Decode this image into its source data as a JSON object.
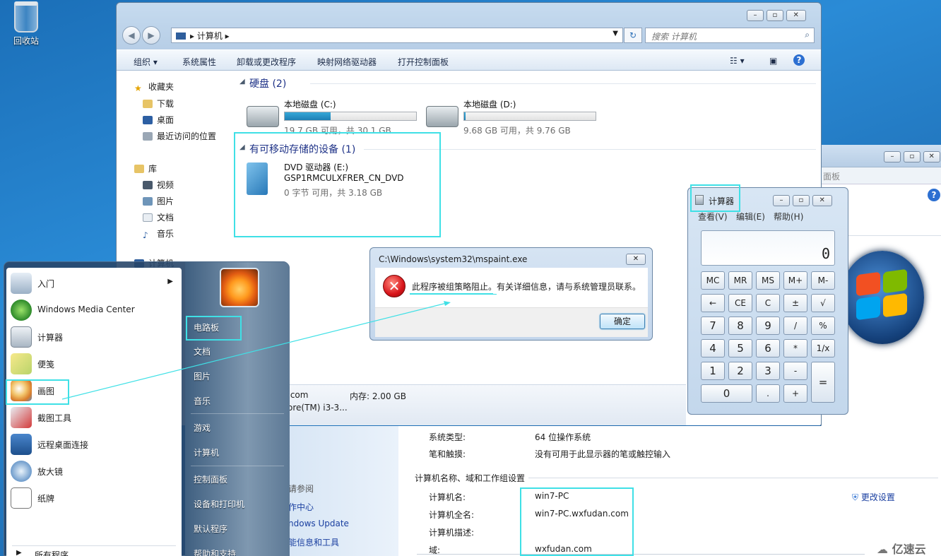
{
  "desktop": {
    "recycle_bin": "回收站"
  },
  "back_window": {
    "address_fragment": "面板"
  },
  "explorer": {
    "address": "计算机",
    "search_placeholder": "搜索 计算机",
    "toolbar": [
      "组织 ▾",
      "系统属性",
      "卸载或更改程序",
      "映射网络驱动器",
      "打开控制面板"
    ],
    "nav": {
      "favorites": "收藏夹",
      "favorites_items": [
        "下载",
        "桌面",
        "最近访问的位置"
      ],
      "libraries": "库",
      "libraries_items": [
        "视频",
        "图片",
        "文档",
        "音乐"
      ],
      "computer": "计算机"
    },
    "hdd_group": "硬盘 (2)",
    "drive_c": {
      "name": "本地磁盘 (C:)",
      "info": "19.7 GB 可用，共 30.1 GB",
      "used_fraction": 0.35
    },
    "drive_d": {
      "name": "本地磁盘 (D:)",
      "info": "9.68 GB 可用，共 9.76 GB",
      "used_fraction": 0.01
    },
    "removable_group": "有可移动存储的设备 (1)",
    "dvd": {
      "name": "DVD 驱动器 (E:)",
      "label": "GSP1RMCULXFRER_CN_DVD",
      "info": "0 字节 可用，共 3.18 GB"
    },
    "details": {
      "domain_fragment": ".com",
      "memory": "内存: 2.00 GB",
      "cpu_fragment": "ore(TM) i3-3..."
    }
  },
  "system": {
    "left_links": [
      "请参阅",
      "作中心",
      "ndows Update",
      "能信息和工具"
    ],
    "os_type_label": "系统类型:",
    "os_type_value": "64 位操作系统",
    "pen_label": "笔和触摸:",
    "pen_value": "没有可用于此显示器的笔或触控输入",
    "section": "计算机名称、域和工作组设置",
    "name_label": "计算机名:",
    "name_value": "win7-PC",
    "fullname_label": "计算机全名:",
    "fullname_value": "win7-PC.wxfudan.com",
    "desc_label": "计算机描述:",
    "domain_label": "域:",
    "domain_value": "wxfudan.com",
    "change_settings": "更改设置"
  },
  "start_menu": {
    "left_items": [
      "入门",
      "Windows Media Center",
      "计算器",
      "便笺",
      "画图",
      "截图工具",
      "远程桌面连接",
      "放大镜",
      "纸牌"
    ],
    "all_programs": "所有程序",
    "right_items": [
      "电路板",
      "文档",
      "图片",
      "音乐",
      "游戏",
      "计算机",
      "控制面板",
      "设备和打印机",
      "默认程序",
      "帮助和支持"
    ]
  },
  "dialog": {
    "title": "C:\\Windows\\system32\\mspaint.exe",
    "message_highlight": "此程序被组策略阻止。",
    "message_rest": "有关详细信息，请与系统管理员联系。",
    "ok": "确定"
  },
  "calculator": {
    "title": "计算器",
    "menu": [
      "查看(V)",
      "编辑(E)",
      "帮助(H)"
    ],
    "display": "0",
    "buttons": [
      "MC",
      "MR",
      "MS",
      "M+",
      "M-",
      "←",
      "CE",
      "C",
      "±",
      "√",
      "7",
      "8",
      "9",
      "/",
      "%",
      "4",
      "5",
      "6",
      "*",
      "1/x",
      "1",
      "2",
      "3",
      "-",
      "=",
      "0",
      ".",
      "+"
    ]
  },
  "watermark": "亿速云"
}
